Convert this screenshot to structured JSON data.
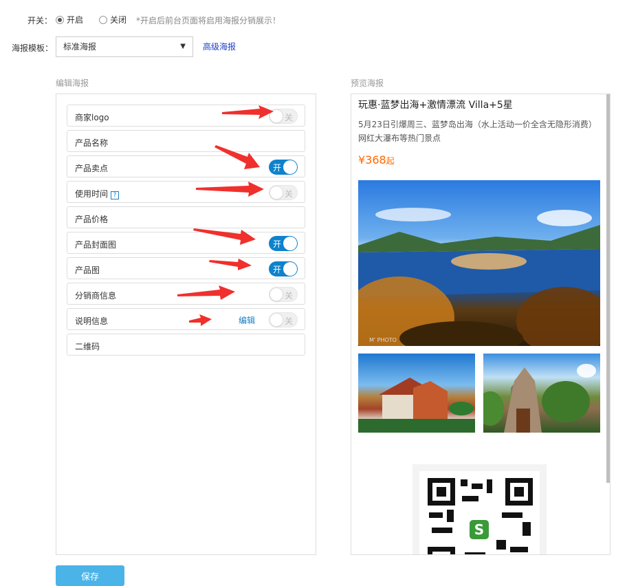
{
  "switch": {
    "label": "开关：",
    "on_label": "开启",
    "off_label": "关闭",
    "hint": "*开启后前台页面将启用海报分销展示！",
    "selected": "on"
  },
  "template": {
    "label": "海报模板：",
    "selected": "标准海报",
    "caret": "▼",
    "advanced_link": "高级海报"
  },
  "edit": {
    "title": "编辑海报",
    "items": [
      {
        "name": "商家logo",
        "toggle": "off",
        "toggle_text": "关"
      },
      {
        "name": "产品名称"
      },
      {
        "name": "产品卖点",
        "toggle": "on",
        "toggle_text": "开"
      },
      {
        "name": "使用时间",
        "help": "?",
        "toggle": "off",
        "toggle_text": "关"
      },
      {
        "name": "产品价格"
      },
      {
        "name": "产品封面图",
        "toggle": "on",
        "toggle_text": "开"
      },
      {
        "name": "产品图",
        "toggle": "on",
        "toggle_text": "开"
      },
      {
        "name": "分销商信息",
        "toggle": "off",
        "toggle_text": "关"
      },
      {
        "name": "说明信息",
        "edit_link": "编辑",
        "toggle": "off",
        "toggle_text": "关"
      },
      {
        "name": "二维码"
      }
    ]
  },
  "preview": {
    "title": "预览海报",
    "product_title": "玩惠·蓝梦出海+激情漂流 Villa+5星",
    "product_desc": "5月23日引爆周三、蓝梦岛出海（水上活动一价全含无隐形消费）网红大瀑布等热门景点",
    "price": "¥368",
    "price_suffix": "起",
    "photo_tag": "M' PHOTO",
    "qr_logo": "S"
  },
  "save_label": "保存",
  "colors": {
    "accent": "#0e82cc",
    "link": "#1a3fc8",
    "price": "#ff6a00",
    "arrow": "#f0302c",
    "save": "#4ab3e8"
  }
}
